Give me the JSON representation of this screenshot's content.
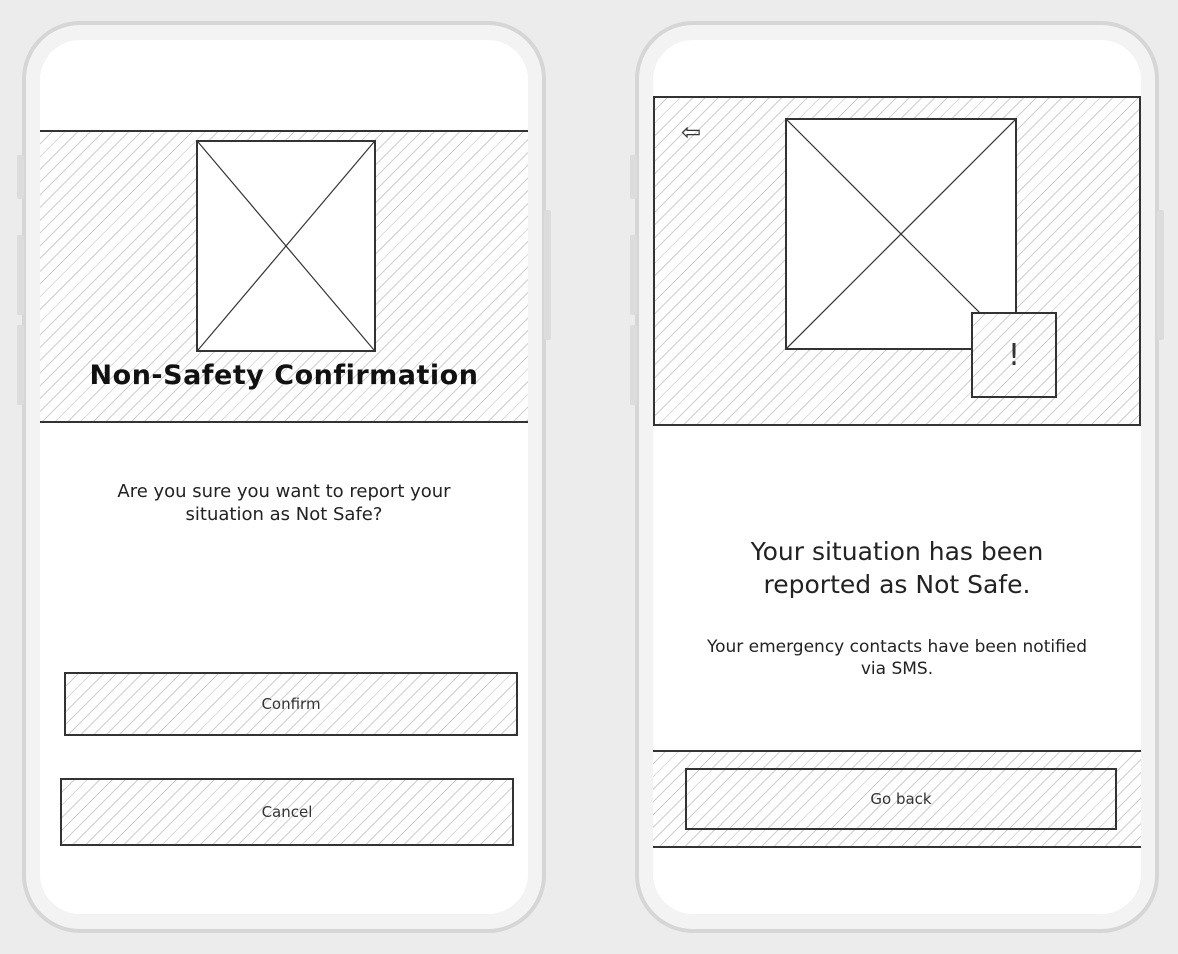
{
  "screen1": {
    "title": "Non-Safety Confirmation",
    "message": "Are you sure you want to report your situation as Not Safe?",
    "confirm_label": "Confirm",
    "cancel_label": "Cancel",
    "image_icon": "image-placeholder-icon"
  },
  "screen2": {
    "back_icon": "back-arrow-icon",
    "back_glyph": "⇦",
    "alert_icon": "exclamation-icon",
    "alert_glyph": "!",
    "heading": "Your situation has been reported as Not Safe.",
    "subtext": "Your emergency contacts have been notified via SMS.",
    "go_back_label": "Go back",
    "image_icon": "image-placeholder-icon"
  }
}
